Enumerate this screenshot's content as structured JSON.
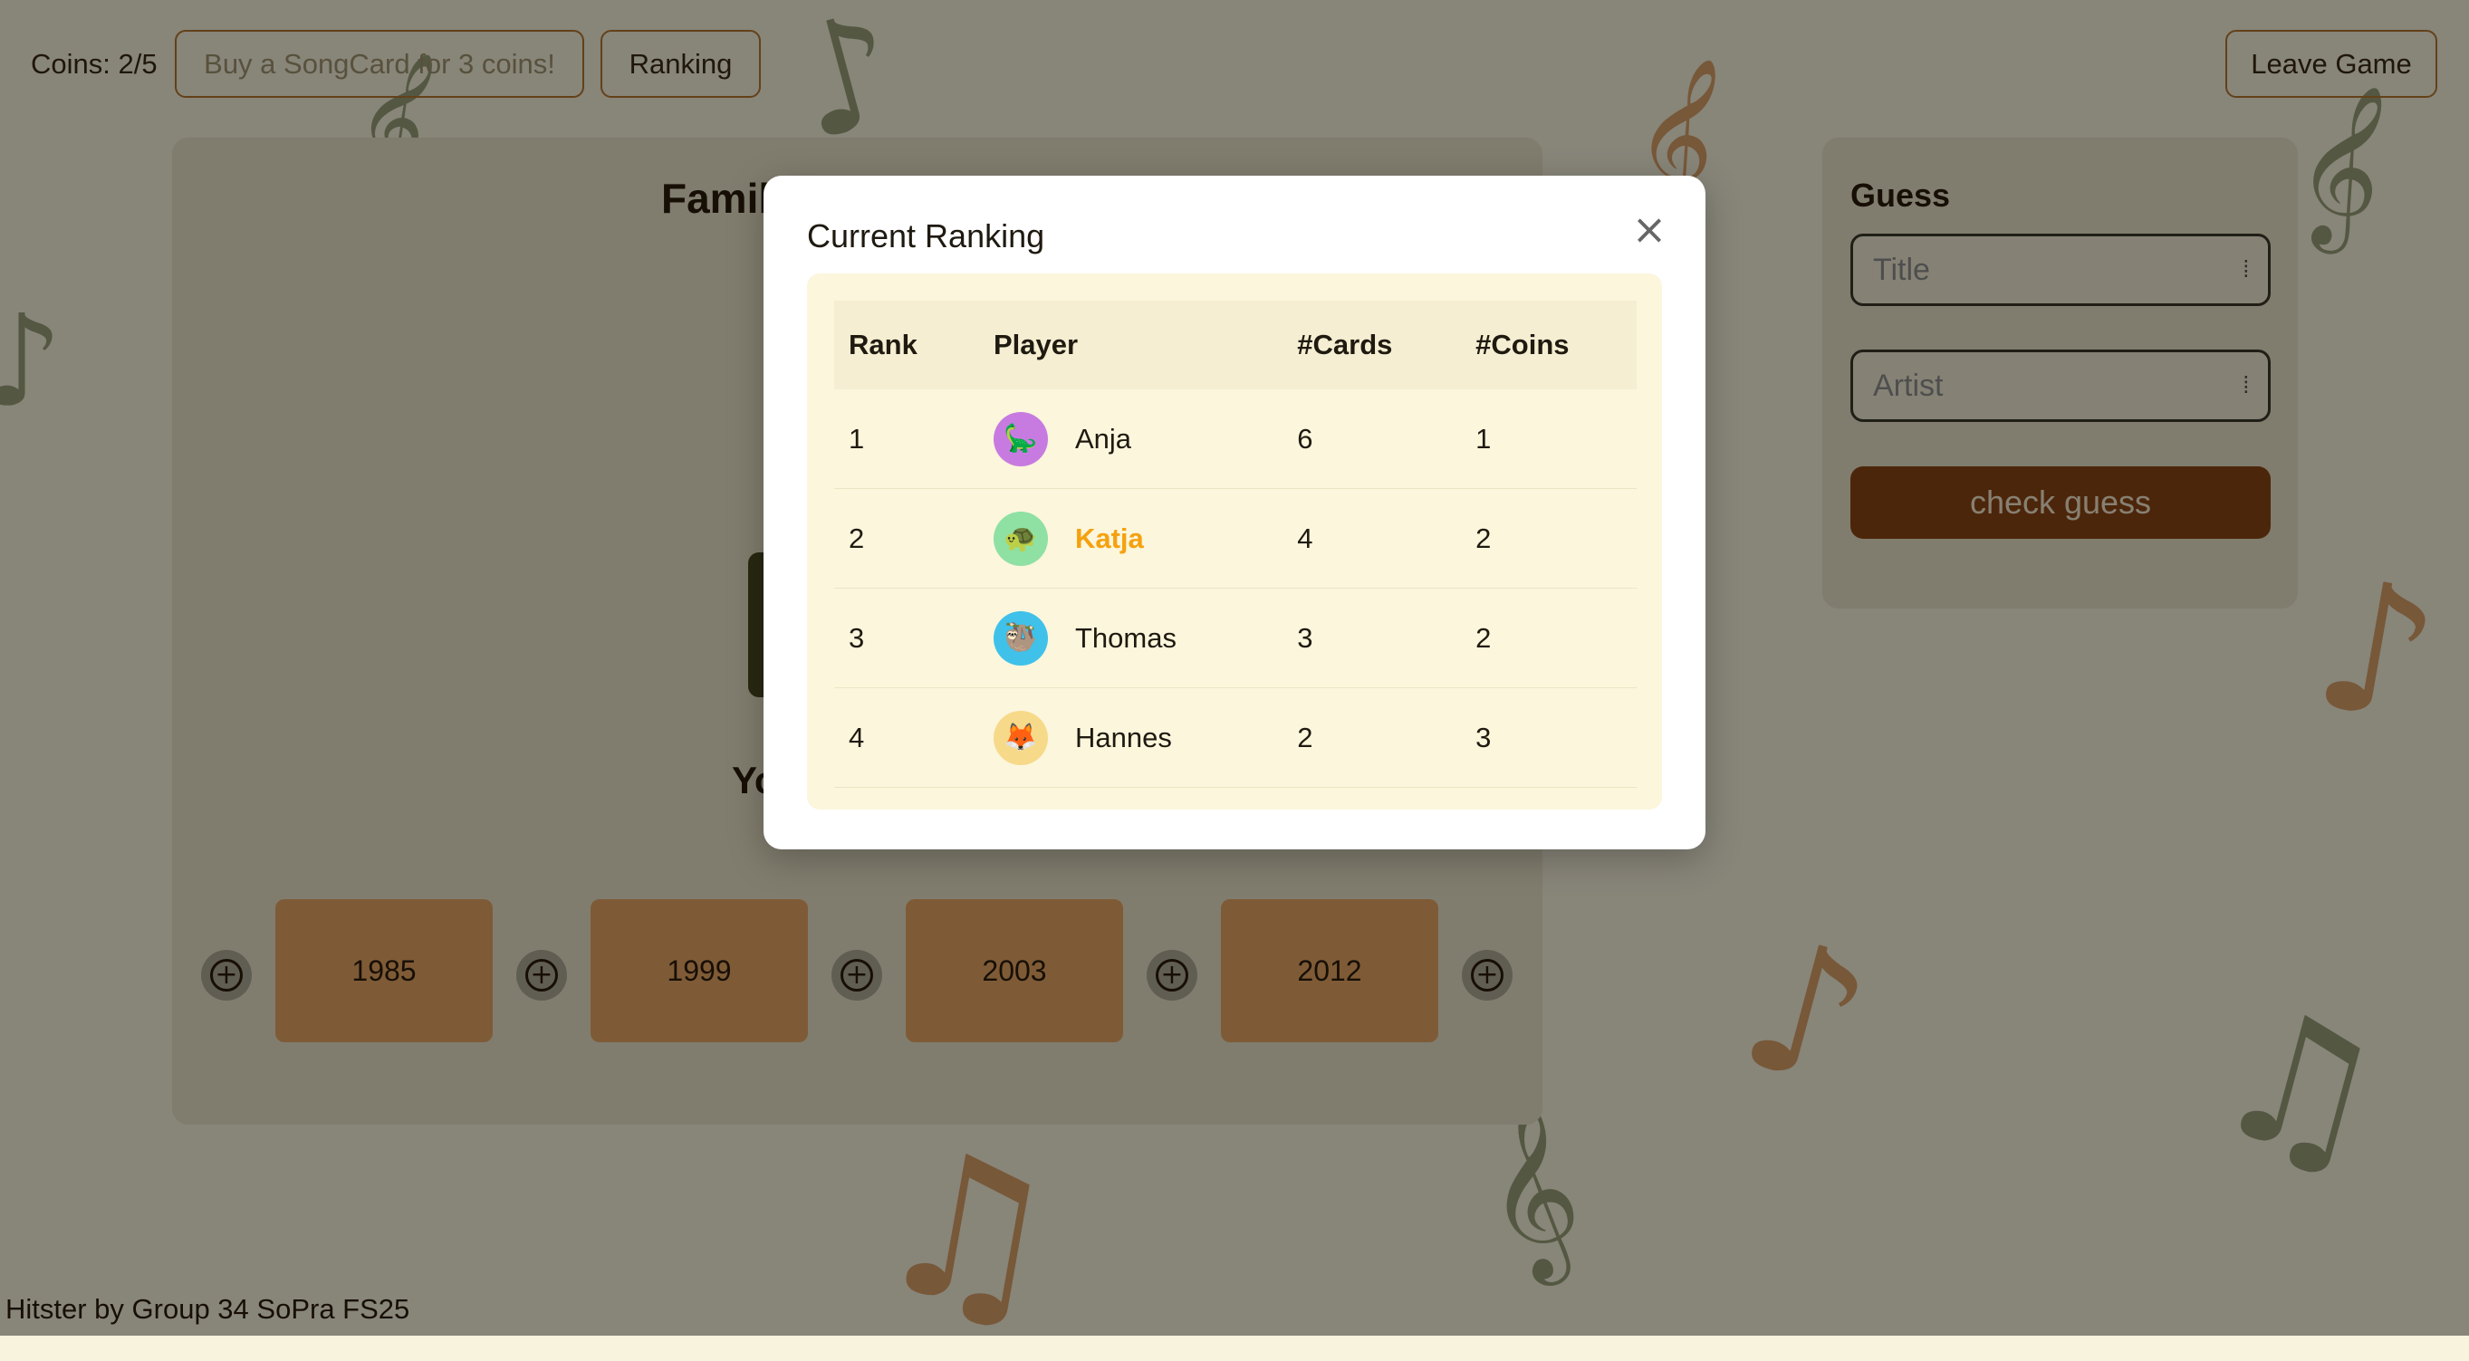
{
  "topbar": {
    "coins": "Coins: 2/5",
    "buy_label": "Buy a SongCard for 3 coins!",
    "ranking_label": "Ranking",
    "leave_label": "Leave Game"
  },
  "game": {
    "title": "Famil",
    "your_turn": "Yo",
    "timeline": [
      "1985",
      "1999",
      "2003",
      "2012"
    ]
  },
  "guess": {
    "title": "Guess",
    "title_placeholder": "Title",
    "artist_placeholder": "Artist",
    "check_label": "check guess"
  },
  "footer": "Hitster by Group 34 SoPra FS25",
  "modal": {
    "title": "Current Ranking",
    "close_icon": "close-icon",
    "columns": [
      "Rank",
      "Player",
      "#Cards",
      "#Coins"
    ],
    "rows": [
      {
        "rank": "1",
        "player": "Anja",
        "cards": "6",
        "coins": "1",
        "avatar": "dinosaur",
        "avatar_bg": "#c77be0",
        "highlight": false
      },
      {
        "rank": "2",
        "player": "Katja",
        "cards": "4",
        "coins": "2",
        "avatar": "turtle",
        "avatar_bg": "#8fe0a3",
        "highlight": true
      },
      {
        "rank": "3",
        "player": "Thomas",
        "cards": "3",
        "coins": "2",
        "avatar": "sloth",
        "avatar_bg": "#3fc1ea",
        "highlight": false
      },
      {
        "rank": "4",
        "player": "Hannes",
        "cards": "2",
        "coins": "3",
        "avatar": "fox",
        "avatar_bg": "#f7d98a",
        "highlight": false
      }
    ]
  },
  "colors": {
    "accent_brown": "#8b4513",
    "highlight_orange": "#f5a10f",
    "card_tan": "#e6a663"
  }
}
